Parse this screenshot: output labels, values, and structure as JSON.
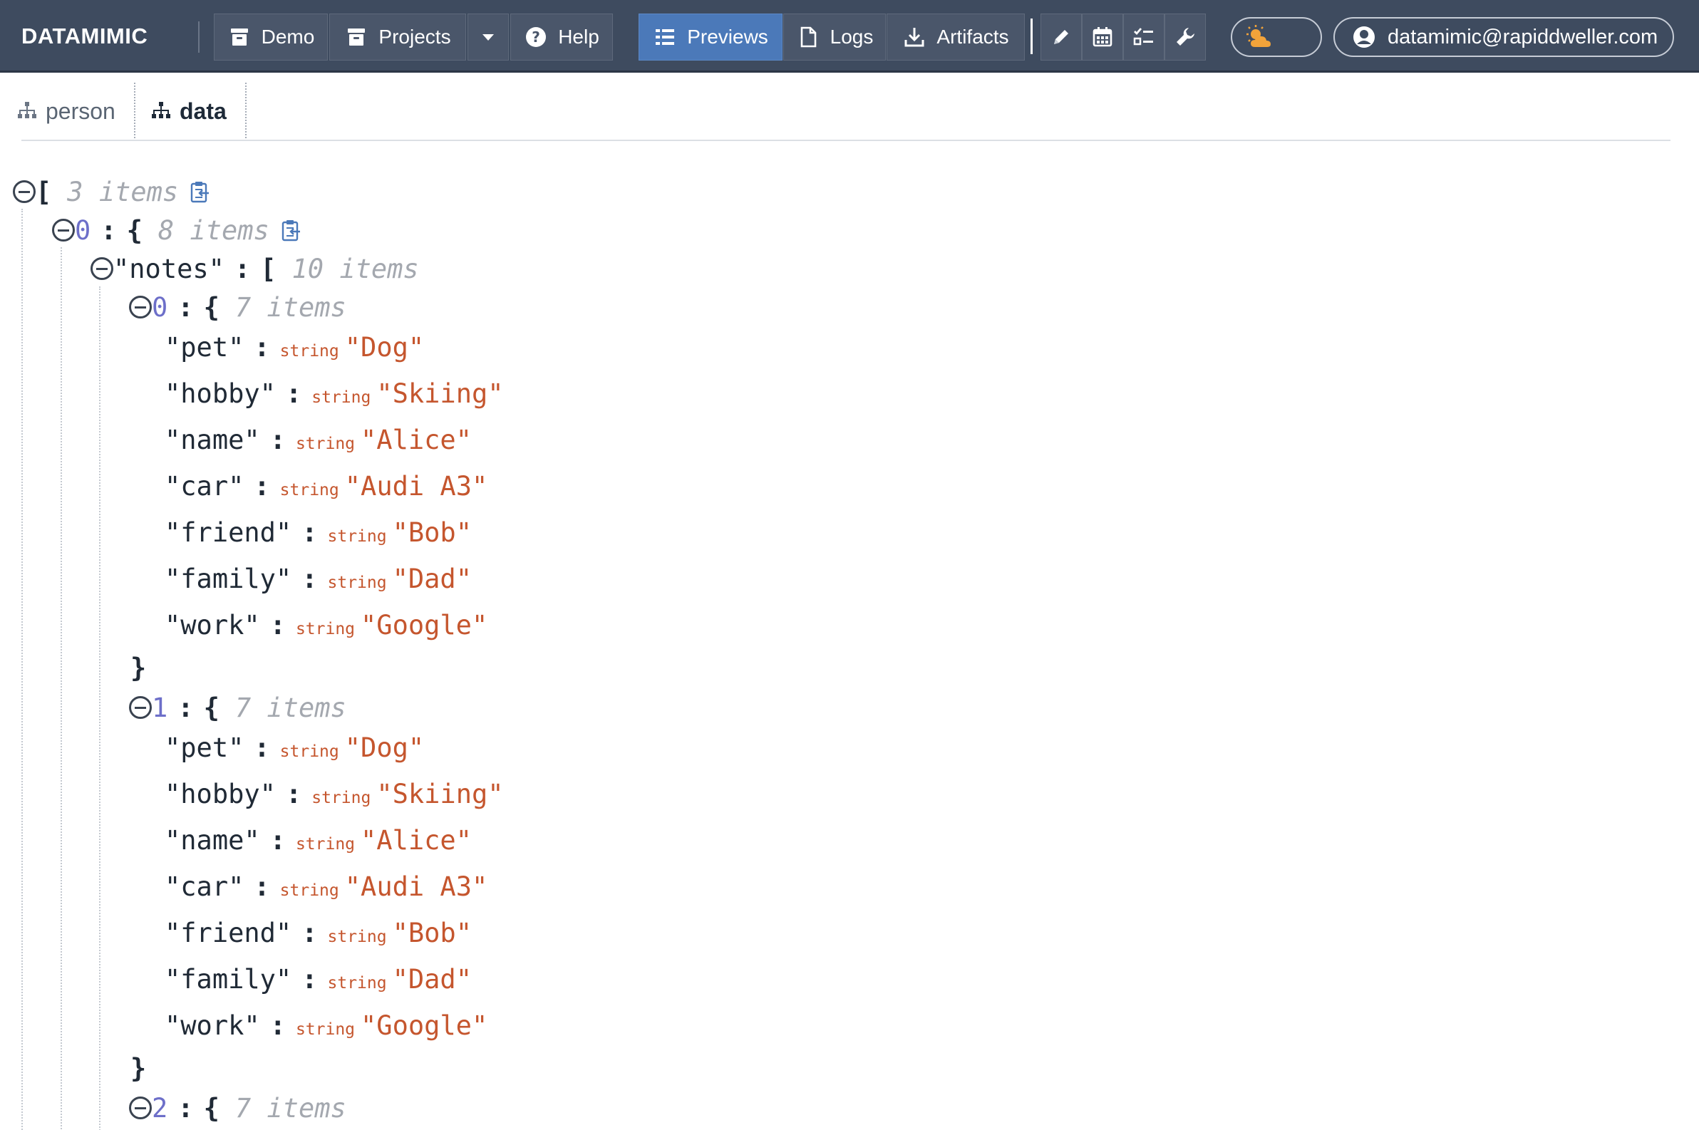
{
  "navbar": {
    "brand": "DATAMIMIC",
    "buttons": {
      "demo": "Demo",
      "projects": "Projects",
      "help": "Help",
      "previews": "Previews",
      "logs": "Logs",
      "artifacts": "Artifacts"
    },
    "tool_icons": [
      "pencil-icon",
      "calendar-icon",
      "checklist-icon",
      "wrench-icon"
    ],
    "theme_icon": "sun-cloud-icon",
    "user": "datamimic@rapiddweller.com",
    "colors": {
      "bar": "#3e4b5f",
      "active": "#4b79b9",
      "accent": "#f2a33a"
    }
  },
  "tabs": [
    {
      "label": "person",
      "active": false
    },
    {
      "label": "data",
      "active": true
    }
  ],
  "tree": {
    "root_count": "3 items",
    "item0_count": "8 items",
    "notes_key": "\"notes\"",
    "notes_count": "10 items",
    "note_count": "7 items",
    "type_label": "string",
    "notes": [
      {
        "index": "0",
        "fields": [
          {
            "key": "\"pet\"",
            "value": "\"Dog\""
          },
          {
            "key": "\"hobby\"",
            "value": "\"Skiing\""
          },
          {
            "key": "\"name\"",
            "value": "\"Alice\""
          },
          {
            "key": "\"car\"",
            "value": "\"Audi A3\""
          },
          {
            "key": "\"friend\"",
            "value": "\"Bob\""
          },
          {
            "key": "\"family\"",
            "value": "\"Dad\""
          },
          {
            "key": "\"work\"",
            "value": "\"Google\""
          }
        ]
      },
      {
        "index": "1",
        "fields": [
          {
            "key": "\"pet\"",
            "value": "\"Dog\""
          },
          {
            "key": "\"hobby\"",
            "value": "\"Skiing\""
          },
          {
            "key": "\"name\"",
            "value": "\"Alice\""
          },
          {
            "key": "\"car\"",
            "value": "\"Audi A3\""
          },
          {
            "key": "\"friend\"",
            "value": "\"Bob\""
          },
          {
            "key": "\"family\"",
            "value": "\"Dad\""
          },
          {
            "key": "\"work\"",
            "value": "\"Google\""
          }
        ]
      },
      {
        "index": "2",
        "fields": []
      }
    ]
  }
}
